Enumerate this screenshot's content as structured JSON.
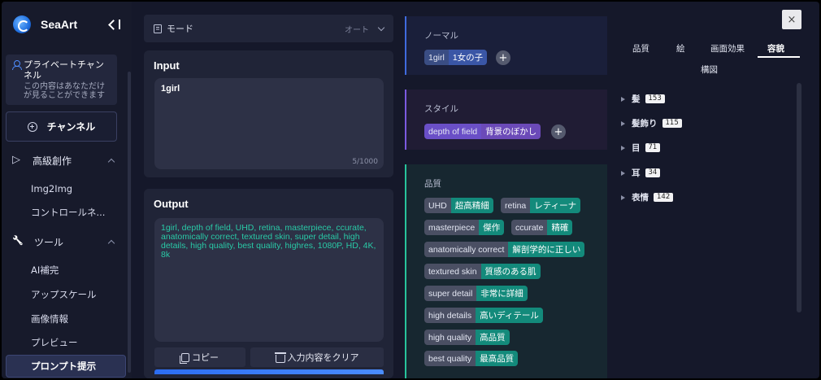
{
  "sidebar": {
    "logo": "SeaArt",
    "private_channel": {
      "title": "プライベートチャンネル",
      "desc": "この内容はあなただけが見ることができます"
    },
    "channel_button": "チャンネル",
    "advanced": "高級創作",
    "advanced_items": [
      "Img2Img",
      "コントロールネ..."
    ],
    "tools": "ツール",
    "tool_items": [
      "AI補完",
      "アップスケール",
      "画像情報",
      "プレビュー"
    ],
    "active_item": "プロンプト提示"
  },
  "mode": {
    "label": "モード",
    "value": "オート"
  },
  "input": {
    "title": "Input",
    "text": "1girl",
    "counter": "5/1000"
  },
  "output": {
    "title": "Output",
    "text": "1girl, depth of field, UHD, retina, masterpiece, ccurate, anatomically correct, textured skin, super detail, high details, high quality, best quality, highres, 1080P, HD, 4K, 8k",
    "copy_label": "コピー",
    "clear_label": "入力内容をクリア"
  },
  "tag_groups": {
    "normal": {
      "title": "ノーマル",
      "tags": [
        {
          "en": "1girl",
          "ja": "1女の子"
        }
      ]
    },
    "style": {
      "title": "スタイル",
      "tags": [
        {
          "en": "depth of field",
          "ja": "背景のぼかし"
        }
      ]
    },
    "quality": {
      "title": "品質",
      "tags": [
        {
          "en": "UHD",
          "ja": "超高精細"
        },
        {
          "en": "retina",
          "ja": "レティーナ"
        },
        {
          "en": "masterpiece",
          "ja": "傑作"
        },
        {
          "en": "ccurate",
          "ja": "精確"
        },
        {
          "en": "anatomically correct",
          "ja": "解剖学的に正しい"
        },
        {
          "en": "textured skin",
          "ja": "質感のある肌"
        },
        {
          "en": "super detail",
          "ja": "非常に詳細"
        },
        {
          "en": "high details",
          "ja": "高いディテール"
        },
        {
          "en": "high quality",
          "ja": "高品質"
        },
        {
          "en": "best quality",
          "ja": "最高品質"
        }
      ]
    },
    "plus": "+"
  },
  "right_panel": {
    "close": "×",
    "tabs": [
      "品質",
      "絵",
      "画面効果",
      "容貌",
      "構図"
    ],
    "active_tab": "容貌",
    "tree": [
      {
        "label": "髪",
        "count": "153"
      },
      {
        "label": "髪飾り",
        "count": "115"
      },
      {
        "label": "目",
        "count": "71"
      },
      {
        "label": "耳",
        "count": "34"
      },
      {
        "label": "表情",
        "count": "142"
      }
    ]
  },
  "colors": {
    "background": "#15182a",
    "accent_blue": "#2c6df1",
    "output_text": "#29c9a6",
    "quality_tag": "#138a7b",
    "style_tag": "#6a4fc7"
  }
}
